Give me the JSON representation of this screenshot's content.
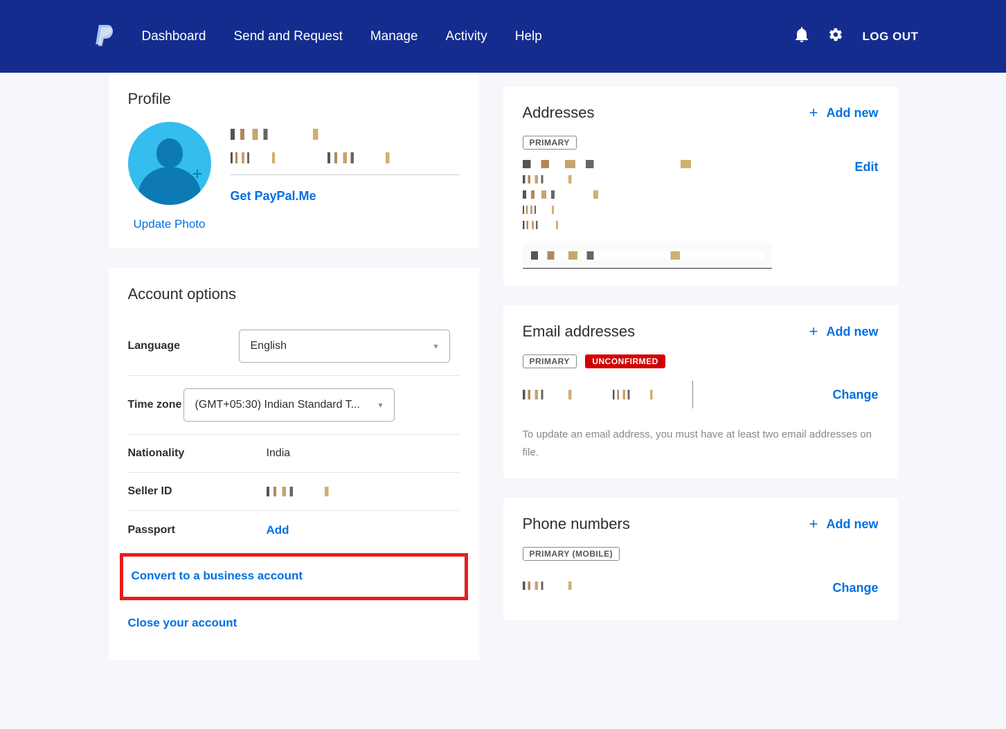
{
  "header": {
    "nav": [
      "Dashboard",
      "Send and Request",
      "Manage",
      "Activity",
      "Help"
    ],
    "logout": "LOG OUT"
  },
  "profile": {
    "title": "Profile",
    "update_photo": "Update Photo",
    "paypal_me": "Get PayPal.Me"
  },
  "account_options": {
    "title": "Account options",
    "rows": {
      "language": {
        "label": "Language",
        "value": "English"
      },
      "timezone": {
        "label": "Time zone",
        "value": "(GMT+05:30) Indian Standard T..."
      },
      "nationality": {
        "label": "Nationality",
        "value": "India"
      },
      "seller_id": {
        "label": "Seller ID"
      },
      "passport": {
        "label": "Passport",
        "action": "Add"
      }
    },
    "convert": "Convert to a business account",
    "close": "Close your account"
  },
  "addresses": {
    "title": "Addresses",
    "add_new": "Add new",
    "primary_badge": "PRIMARY",
    "edit": "Edit"
  },
  "emails": {
    "title": "Email addresses",
    "add_new": "Add new",
    "primary_badge": "PRIMARY",
    "unconfirmed_badge": "UNCONFIRMED",
    "change": "Change",
    "note": "To update an email address, you must have at least two email addresses on file."
  },
  "phones": {
    "title": "Phone numbers",
    "add_new": "Add new",
    "primary_badge": "PRIMARY (MOBILE)",
    "change": "Change"
  }
}
